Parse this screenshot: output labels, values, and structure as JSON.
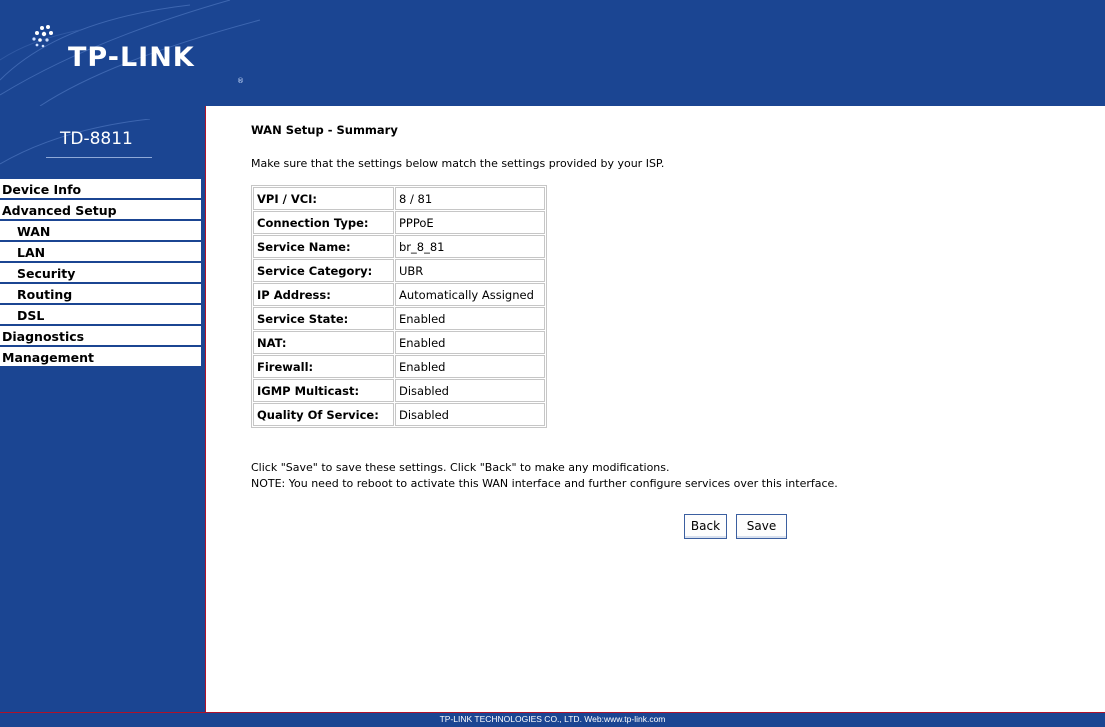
{
  "header": {
    "logo_text": "TP-LINK",
    "logo_reg": "®"
  },
  "sidebar": {
    "model": "TD-8811",
    "items": [
      {
        "label": "Device Info",
        "sub": false
      },
      {
        "label": "Advanced Setup",
        "sub": false
      },
      {
        "label": "WAN",
        "sub": true
      },
      {
        "label": "LAN",
        "sub": true
      },
      {
        "label": "Security",
        "sub": true
      },
      {
        "label": "Routing",
        "sub": true
      },
      {
        "label": "DSL",
        "sub": true
      },
      {
        "label": "Diagnostics",
        "sub": false
      },
      {
        "label": "Management",
        "sub": false
      }
    ]
  },
  "main": {
    "title": "WAN Setup - Summary",
    "intro": "Make sure that the settings below match the settings provided by your ISP.",
    "rows": [
      {
        "key": "VPI / VCI:",
        "value": "8 / 81"
      },
      {
        "key": "Connection Type:",
        "value": "PPPoE"
      },
      {
        "key": "Service Name:",
        "value": "br_8_81"
      },
      {
        "key": "Service Category:",
        "value": "UBR"
      },
      {
        "key": "IP Address:",
        "value": "Automatically Assigned"
      },
      {
        "key": "Service State:",
        "value": "Enabled"
      },
      {
        "key": "NAT:",
        "value": "Enabled"
      },
      {
        "key": "Firewall:",
        "value": "Enabled"
      },
      {
        "key": "IGMP Multicast:",
        "value": "Disabled"
      },
      {
        "key": "Quality Of Service:",
        "value": "Disabled"
      }
    ],
    "note1": "Click \"Save\" to save these settings. Click \"Back\" to make any modifications.",
    "note2": "NOTE: You need to reboot to activate this WAN interface and further configure services over this interface.",
    "back_label": "Back",
    "save_label": "Save"
  },
  "footer": {
    "text": "TP-LINK TECHNOLOGIES CO., LTD. Web:www.tp-link.com"
  },
  "colors": {
    "brand_blue": "#1b4592",
    "accent_red": "#b0122a"
  }
}
